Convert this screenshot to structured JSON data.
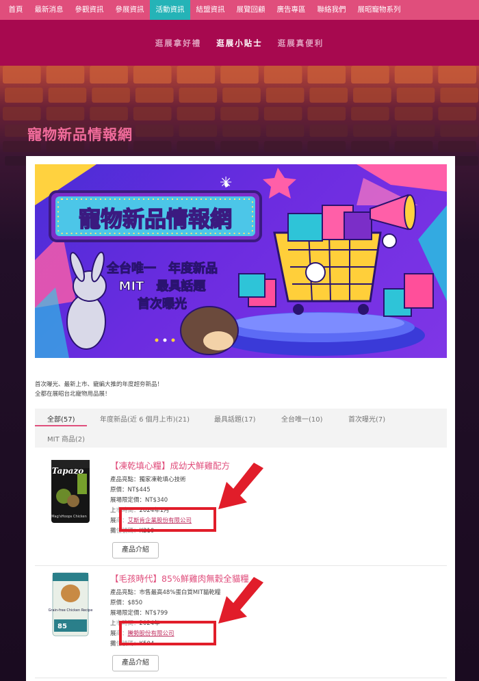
{
  "nav": {
    "items": [
      "首頁",
      "最新消息",
      "參觀資訊",
      "參展資訊",
      "活動資訊",
      "結盟資訊",
      "展覽回顧",
      "廣告專區",
      "聯絡我們",
      "展昭寵物系列"
    ],
    "active_index": 4
  },
  "subnav": {
    "items": [
      "逛展拿好禮",
      "逛展小貼士",
      "逛展真便利"
    ],
    "active_index": 1
  },
  "page": {
    "heading": "寵物新品情報網"
  },
  "banner": {
    "title": "寵物新品情報網",
    "line1": "全台唯一　年度新品",
    "line2": "MIT　最具話題",
    "line3": "首次曝光"
  },
  "intro": {
    "line1": "首次曝光、最新上市、寵編大推的年度超夯新品！",
    "line2": "全都在展昭台北寵物用品展！"
  },
  "tabs": [
    {
      "label": "全部(57)"
    },
    {
      "label": "年度新品(近 6 個月上市)(21)"
    },
    {
      "label": "最具話題(17)"
    },
    {
      "label": "全台唯一(10)"
    },
    {
      "label": "首次曝光(7)"
    },
    {
      "label": "MIT 商品(2)"
    }
  ],
  "products": [
    {
      "title": "【凍乾填心糧】成幼犬鮮雞配方",
      "highlight": "產品亮點：獨家凍乾填心技術",
      "price": "原價：NT$445",
      "special": "展場限定價：NT$340",
      "launch_partial": "上",
      "launch_hidden": "2024年1月",
      "exhibitor_prefix": "展",
      "exhibitor": "艾斯肯企業股份有限公司",
      "booth_partial": "攤",
      "booth_hidden": "K210",
      "button": "產品介紹",
      "package_brand": "Tapazo",
      "package_sub": "Mag'sHoops Chicken"
    },
    {
      "title": "【毛孩時代】85%鮮雞肉無穀全貓糧",
      "highlight": "產品亮點：市售最高48%蛋白質MIT貓乾糧",
      "price": "原價：$850",
      "special": "展場限定價：NT$799",
      "launch_partial": "上",
      "launch_hidden": "2024年",
      "exhibitor_prefix": "展",
      "exhibitor": "騰勢股份有限公司",
      "booth_partial": "攤",
      "booth_hidden": "K504",
      "button": "產品介紹",
      "package_brand": "Grain-free Chicken Recipe",
      "package_sub": "85"
    }
  ],
  "colors": {
    "nav": "#e04e7c",
    "nav_active": "#25b3b7",
    "subnav": "#a7094f",
    "heading": "#f06b9b",
    "alert": "#e11d2a"
  }
}
